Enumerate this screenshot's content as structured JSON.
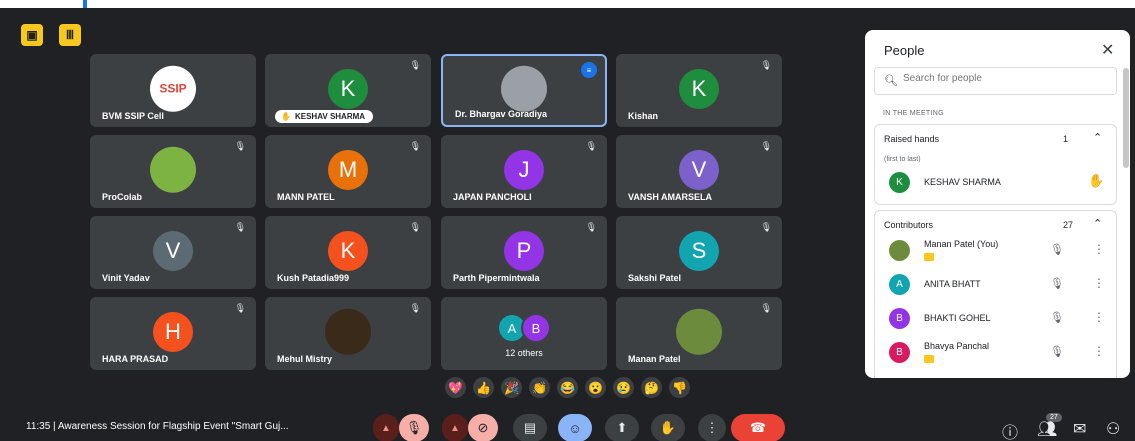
{
  "top_buttons": [
    {
      "icon": "share-screen-icon",
      "glyph": "▣"
    },
    {
      "icon": "layout-icon",
      "glyph": "Ⅲ"
    }
  ],
  "tiles": [
    {
      "name": "BVM SSIP Cell",
      "avatar_letter": "SSIP",
      "avatar_color": "#ffffff",
      "muted": false,
      "logo": true
    },
    {
      "name": "KESHAV SHARMA",
      "avatar_letter": "K",
      "avatar_color": "#1e8e3e",
      "muted": true,
      "hand_raised": true
    },
    {
      "name": "Dr. Bhargav Goradiya",
      "avatar_letter": "",
      "avatar_color": "#9aa0a6",
      "muted": false,
      "speaking": true,
      "photo": true
    },
    {
      "name": "Kishan",
      "avatar_letter": "K",
      "avatar_color": "#1e8e3e",
      "muted": true
    },
    {
      "name": "ProColab",
      "avatar_letter": "",
      "avatar_color": "#7cb342",
      "muted": true,
      "photo": true
    },
    {
      "name": "MANN PATEL",
      "avatar_letter": "M",
      "avatar_color": "#e8710a",
      "muted": true
    },
    {
      "name": "JAPAN PANCHOLI",
      "avatar_letter": "J",
      "avatar_color": "#9334e6",
      "muted": true
    },
    {
      "name": "VANSH AMARSELA",
      "avatar_letter": "V",
      "avatar_color": "#7b61c9",
      "muted": true
    },
    {
      "name": "Vinit Yadav",
      "avatar_letter": "V",
      "avatar_color": "#5c6b73",
      "muted": true
    },
    {
      "name": "Kush Patadia999",
      "avatar_letter": "K",
      "avatar_color": "#f4511e",
      "muted": true
    },
    {
      "name": "Parth Pipermintwala",
      "avatar_letter": "P",
      "avatar_color": "#9334e6",
      "muted": true
    },
    {
      "name": "Sakshi Patel",
      "avatar_letter": "S",
      "avatar_color": "#12a4af",
      "muted": true
    },
    {
      "name": "HARA PRASAD",
      "avatar_letter": "H",
      "avatar_color": "#f4511e",
      "muted": true
    },
    {
      "name": "Mehul Mistry",
      "avatar_letter": "",
      "avatar_color": "#3a2a1a",
      "muted": true,
      "photo": true
    },
    {
      "name": "",
      "others_label": "12 others",
      "others": [
        {
          "letter": "A",
          "color": "#12a4af"
        },
        {
          "letter": "B",
          "color": "#9334e6"
        }
      ]
    },
    {
      "name": "Manan Patel",
      "avatar_letter": "",
      "avatar_color": "#6d8b3c",
      "muted": true,
      "photo": true
    }
  ],
  "reactions": [
    "💖",
    "👍",
    "🎉",
    "👏",
    "😂",
    "😮",
    "😢",
    "🤔",
    "👎"
  ],
  "meeting": {
    "time_title": "11:35  |  Awareness Session for Flagship Event \"Smart Guj..."
  },
  "controls": [
    "▲",
    "🎙",
    "▲",
    "⊘",
    "▤",
    "☺",
    "⬆",
    "✋",
    "⋮",
    "☎"
  ],
  "right_controls": {
    "participants_count": "27"
  },
  "people_panel": {
    "title": "People",
    "search_placeholder": "Search for people",
    "in_meeting_label": "IN THE MEETING",
    "raised_hands": {
      "label": "Raised hands",
      "count": "1",
      "order_note": "(first to last)",
      "people": [
        {
          "name": "KESHAV SHARMA",
          "letter": "K",
          "color": "#1e8e3e"
        }
      ]
    },
    "contributors": {
      "label": "Contributors",
      "count": "27",
      "people": [
        {
          "name": "Manan Patel (You)",
          "letter": "",
          "color": "#6d8b3c",
          "flag": true
        },
        {
          "name": "ANITA BHATT",
          "letter": "A",
          "color": "#12a4af",
          "flag": false
        },
        {
          "name": "BHAKTI GOHEL",
          "letter": "B",
          "color": "#9334e6",
          "flag": false
        },
        {
          "name": "Bhavya Panchal",
          "letter": "B",
          "color": "#d81b60",
          "flag": true
        }
      ]
    }
  }
}
